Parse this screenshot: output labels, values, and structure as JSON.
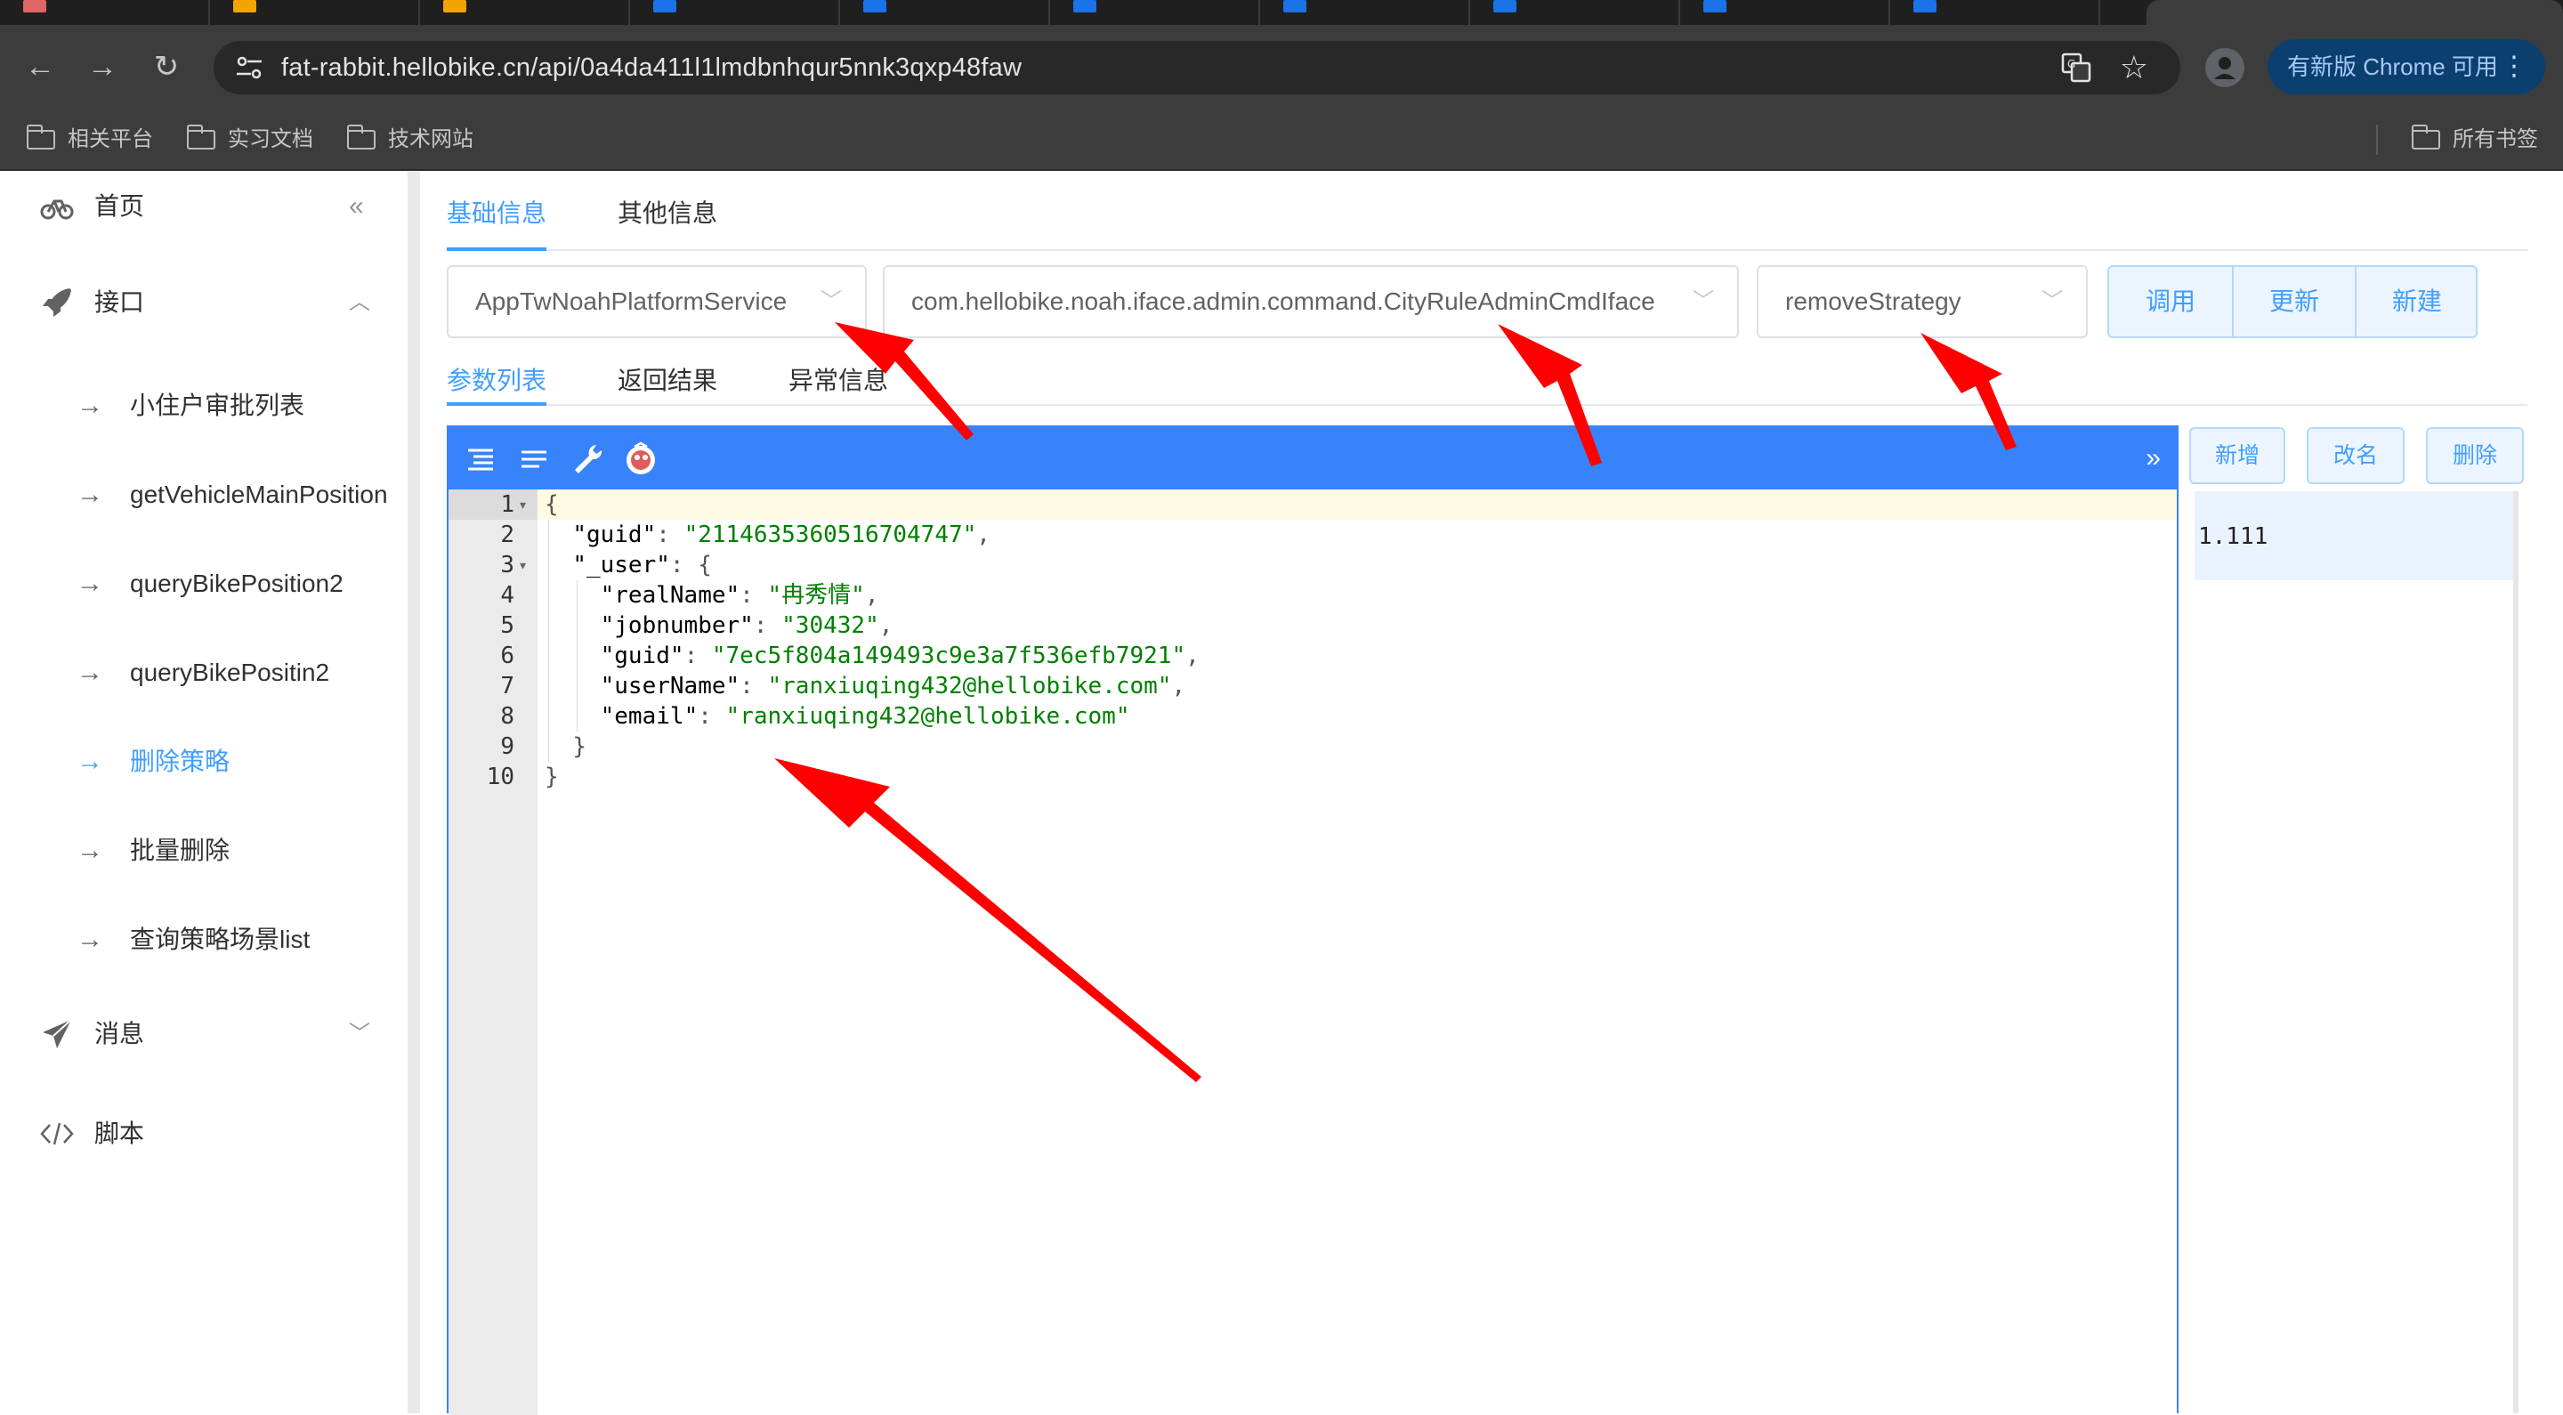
{
  "browser": {
    "url": "fat-rabbit.hellobike.cn/api/0a4da411l1lmdbnhqur5nnk3qxp48faw",
    "update_label": "有新版 Chrome 可用",
    "bookmarks": [
      "相关平台",
      "实习文档",
      "技术网站"
    ],
    "all_bookmarks": "所有书签"
  },
  "sidebar": {
    "home": "首页",
    "api_menu": "接口",
    "items": [
      "小住户审批列表",
      "getVehicleMainPosition",
      "queryBikePosition2",
      "queryBikePositin2",
      "删除策略",
      "批量删除",
      "查询策略场景list"
    ],
    "active_item": "删除策略",
    "message": "消息",
    "script": "脚本"
  },
  "main": {
    "tabs": [
      "基础信息",
      "其他信息"
    ],
    "service_select": "AppTwNoahPlatformService",
    "interface_select": "com.hellobike.noah.iface.admin.command.CityRuleAdminCmdIface",
    "method_select": "removeStrategy",
    "actions": [
      "调用",
      "更新",
      "新建"
    ],
    "sub_tabs": [
      "参数列表",
      "返回结果",
      "异常信息"
    ]
  },
  "editor": {
    "lines": [
      {
        "n": "1",
        "fold": true
      },
      {
        "n": "2",
        "key": "guid",
        "value": "2114635360516704747"
      },
      {
        "n": "3",
        "fold": true,
        "key": "_user"
      },
      {
        "n": "4",
        "key": "realName",
        "value": "冉秀情"
      },
      {
        "n": "5",
        "key": "jobnumber",
        "value": "30432"
      },
      {
        "n": "6",
        "key": "guid",
        "value": "7ec5f804a149493c9e3a7f536efb7921"
      },
      {
        "n": "7",
        "key": "userName",
        "value": "ranxiuqing432@hellobike.com"
      },
      {
        "n": "8",
        "key": "email",
        "value": "ranxiuqing432@hellobike.com"
      },
      {
        "n": "9"
      },
      {
        "n": "10"
      }
    ]
  },
  "right_panel": {
    "buttons": [
      "新增",
      "改名",
      "删除"
    ],
    "items": [
      "1.111"
    ]
  },
  "colors": {
    "accent": "#409eff",
    "editor_bar": "#3883fa",
    "annotation": "#ff0000"
  }
}
